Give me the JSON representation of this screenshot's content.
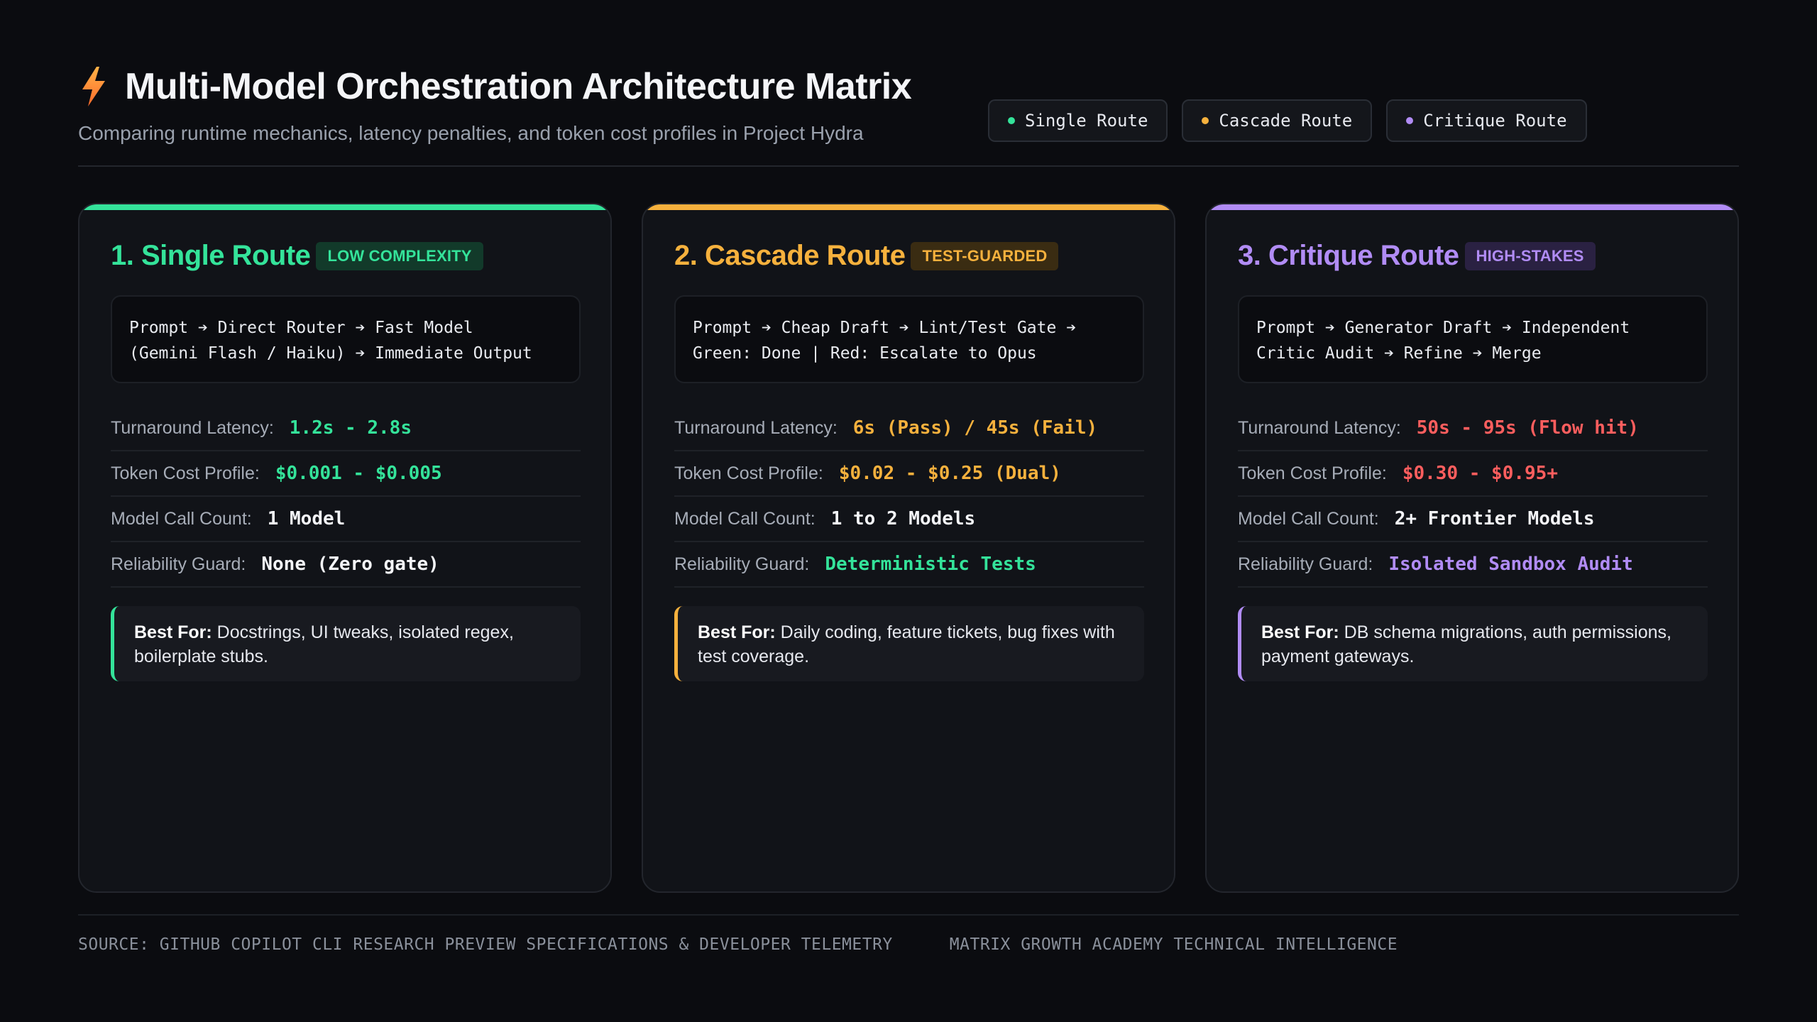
{
  "header": {
    "title": "Multi-Model Orchestration Architecture Matrix",
    "subtitle": "Comparing runtime mechanics, latency penalties, and token cost profiles in Project Hydra",
    "icon": "bolt-icon",
    "legend": [
      {
        "label": "Single Route",
        "color": "#34e39a"
      },
      {
        "label": "Cascade Route",
        "color": "#f6b13d"
      },
      {
        "label": "Critique Route",
        "color": "#b18cf5"
      }
    ]
  },
  "colors": {
    "green": "#34e39a",
    "amber": "#f6b13d",
    "purple": "#b18cf5",
    "red": "#ff5e5e",
    "white": "#f4f5f8"
  },
  "cards": [
    {
      "title": "1. Single Route",
      "badge": "LOW COMPLEXITY",
      "flow": "Prompt ➔ Direct Router ➔ Fast Model\n(Gemini Flash / Haiku) ➔ Immediate Output",
      "metrics": [
        {
          "label": "Turnaround Latency:",
          "value": "1.2s - 2.8s"
        },
        {
          "label": "Token Cost Profile:",
          "value": "$0.001 - $0.005"
        },
        {
          "label": "Model Call Count:",
          "value": "1 Model"
        },
        {
          "label": "Reliability Guard:",
          "value": "None (Zero gate)"
        }
      ],
      "bestfor_label": "Best For:",
      "bestfor_text": " Docstrings, UI tweaks, isolated regex, boilerplate stubs."
    },
    {
      "title": "2. Cascade Route",
      "badge": "TEST-GUARDED",
      "flow": "Prompt ➔ Cheap Draft ➔ Lint/Test Gate ➔\nGreen: Done | Red: Escalate to Opus",
      "metrics": [
        {
          "label": "Turnaround Latency:",
          "value": "6s (Pass) / 45s (Fail)"
        },
        {
          "label": "Token Cost Profile:",
          "value": "$0.02 - $0.25 (Dual)"
        },
        {
          "label": "Model Call Count:",
          "value": "1 to 2 Models"
        },
        {
          "label": "Reliability Guard:",
          "value": "Deterministic Tests"
        }
      ],
      "bestfor_label": "Best For:",
      "bestfor_text": " Daily coding, feature tickets, bug fixes with test coverage."
    },
    {
      "title": "3. Critique Route",
      "badge": "HIGH-STAKES",
      "flow": "Prompt ➔ Generator Draft ➔ Independent\nCritic Audit ➔ Refine ➔ Merge",
      "metrics": [
        {
          "label": "Turnaround Latency:",
          "value": "50s - 95s (Flow hit)"
        },
        {
          "label": "Token Cost Profile:",
          "value": "$0.30 - $0.95+"
        },
        {
          "label": "Model Call Count:",
          "value": "2+ Frontier Models"
        },
        {
          "label": "Reliability Guard:",
          "value": "Isolated Sandbox Audit"
        }
      ],
      "bestfor_label": "Best For:",
      "bestfor_text": " DB schema migrations, auth permissions, payment gateways."
    }
  ],
  "footer": {
    "source": "SOURCE: GITHUB COPILOT CLI RESEARCH PREVIEW SPECIFICATIONS & DEVELOPER TELEMETRY",
    "brand": "MATRIX GROWTH ACADEMY TECHNICAL INTELLIGENCE"
  }
}
